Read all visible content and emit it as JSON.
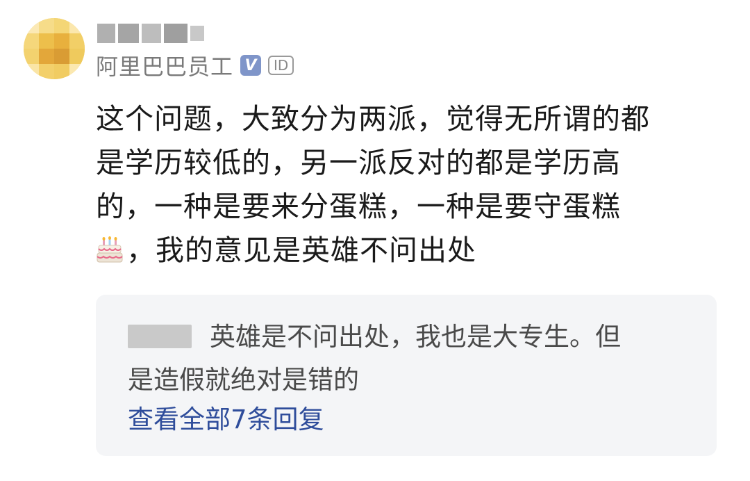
{
  "comment": {
    "author": {
      "employer": "阿里巴巴员工",
      "verified_badge": "V",
      "id_badge": "ID",
      "avatar_color": "#f3d46a",
      "verified_color": "#7f95c9"
    },
    "content_lines": [
      "这个问题，大致分为两派，觉得无所谓的都",
      "是学历较低的，另一派反对的都是学历高",
      "的，一种是要来分蛋糕，一种是要守蛋糕",
      "，我的意见是英雄不问出处"
    ],
    "cake_icon": "birthday-cake-icon"
  },
  "reply": {
    "text_lines": [
      "英雄是不问出处，我也是大专生。但",
      "是造假就绝对是错的"
    ],
    "view_all_label": "查看全部7条回复",
    "link_color": "#2f4d9b",
    "background_color": "#f4f5f7"
  }
}
